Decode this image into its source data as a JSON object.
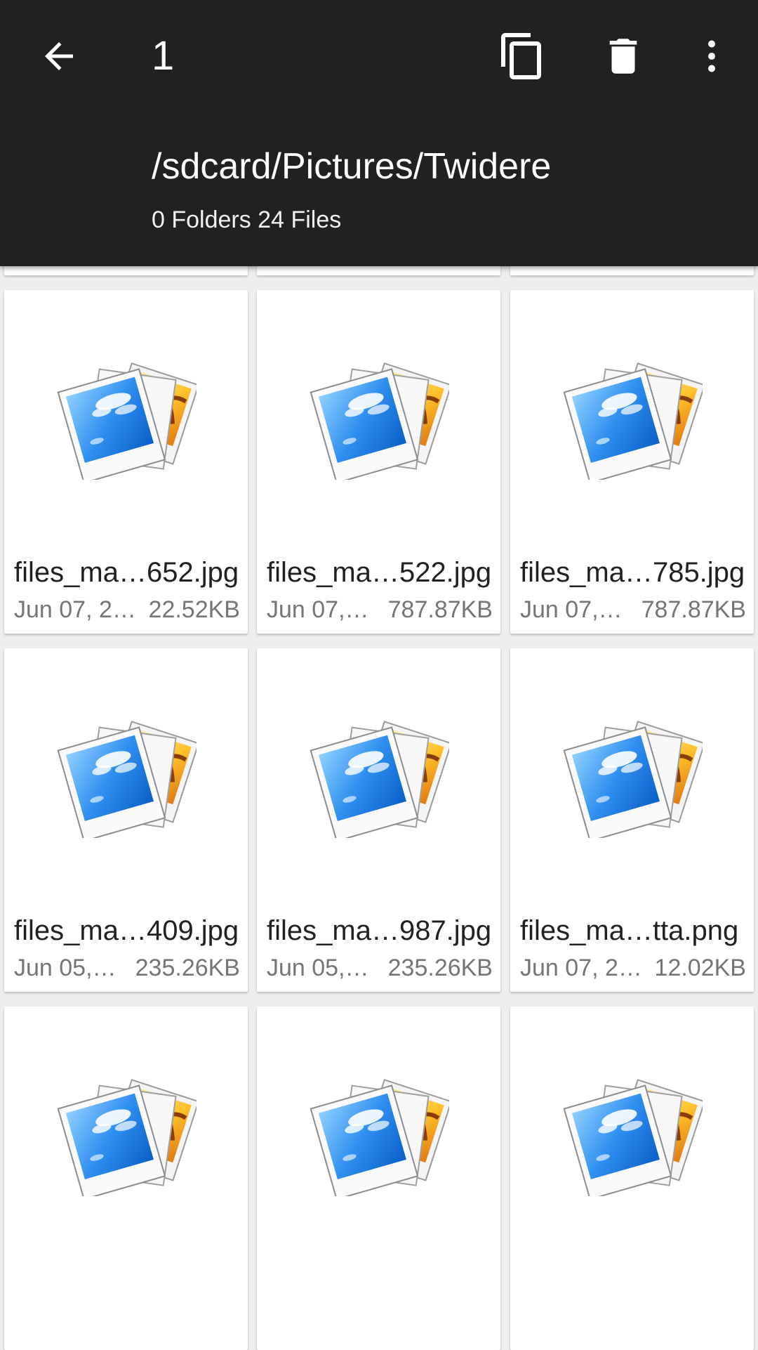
{
  "action_bar": {
    "selected_count": "1",
    "path": "/sdcard/Pictures/Twidere",
    "summary": "0 Folders 24 Files",
    "background": "#212121",
    "icons": {
      "back": "arrow-back-icon",
      "copy": "copy-icon",
      "delete": "trash-icon",
      "more": "more-vert-icon"
    }
  },
  "files": [
    {
      "name": "files_ma…652.jpg",
      "date": "Jun 07, 2…",
      "size": "22.52KB"
    },
    {
      "name": "files_ma…522.jpg",
      "date": "Jun 07,…",
      "size": "787.87KB"
    },
    {
      "name": "files_ma…785.jpg",
      "date": "Jun 07,…",
      "size": "787.87KB"
    },
    {
      "name": "files_ma…409.jpg",
      "date": "Jun 05,…",
      "size": "235.26KB"
    },
    {
      "name": "files_ma…987.jpg",
      "date": "Jun 05,…",
      "size": "235.26KB"
    },
    {
      "name": "files_ma…tta.png",
      "date": "Jun 07, 2…",
      "size": "12.02KB"
    },
    {
      "name": "",
      "date": "",
      "size": ""
    },
    {
      "name": "",
      "date": "",
      "size": ""
    },
    {
      "name": "",
      "date": "",
      "size": ""
    }
  ],
  "thumbnail_icon": "photo-stack-icon"
}
